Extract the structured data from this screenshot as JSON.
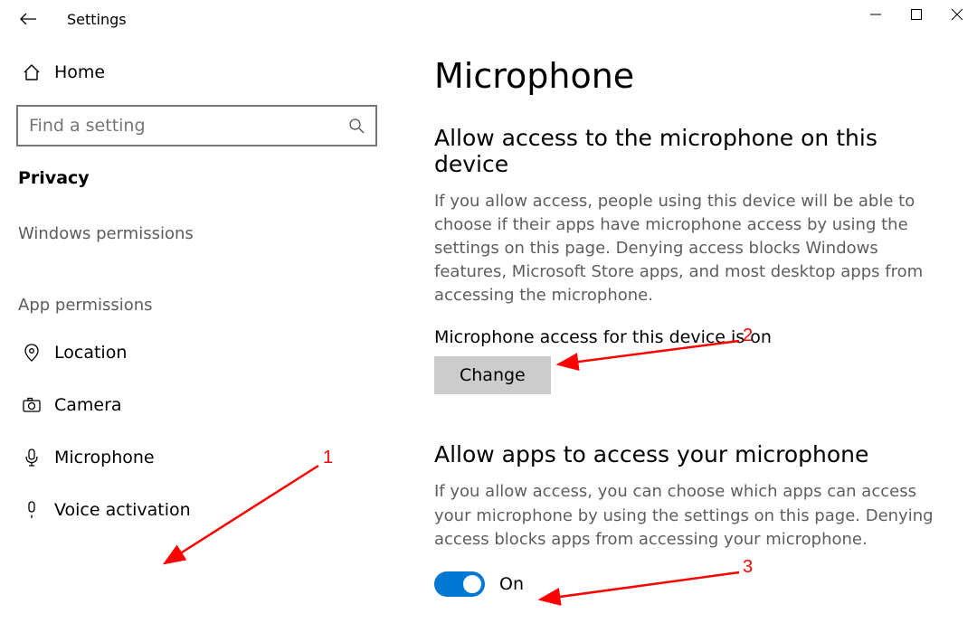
{
  "header": {
    "title": "Settings"
  },
  "sidebar": {
    "home": "Home",
    "search_placeholder": "Find a setting",
    "category": "Privacy",
    "group1": "Windows permissions",
    "group2": "App permissions",
    "items": {
      "location": "Location",
      "camera": "Camera",
      "microphone": "Microphone",
      "voice": "Voice activation"
    }
  },
  "main": {
    "title": "Microphone",
    "section1": {
      "title": "Allow access to the microphone on this device",
      "desc": "If you allow access, people using this device will be able to choose if their apps have microphone access by using the settings on this page. Denying access blocks Windows features, Microsoft Store apps, and most desktop apps from accessing the microphone.",
      "status": "Microphone access for this device is on",
      "change": "Change"
    },
    "section2": {
      "title": "Allow apps to access your microphone",
      "desc": "If you allow access, you can choose which apps can access your microphone by using the settings on this page. Denying access blocks apps from accessing your microphone.",
      "toggle": "On"
    }
  },
  "annotations": {
    "n1": "1",
    "n2": "2",
    "n3": "3"
  }
}
